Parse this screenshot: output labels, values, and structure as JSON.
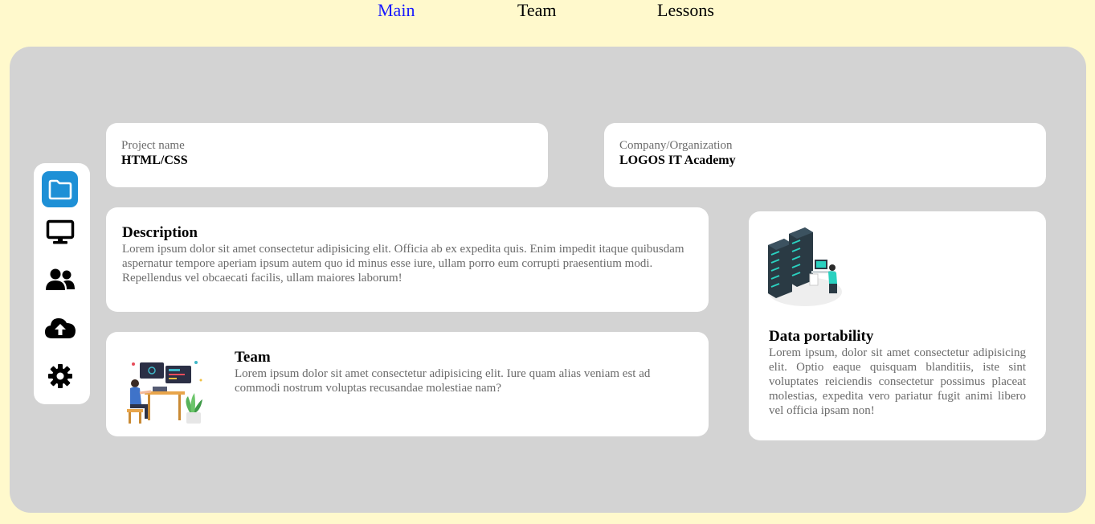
{
  "nav": {
    "main": "Main",
    "team": "Team",
    "lessons": "Lessons"
  },
  "sidebar": {
    "items": [
      {
        "icon": "folder-icon",
        "active": true
      },
      {
        "icon": "monitor-icon",
        "active": false
      },
      {
        "icon": "users-icon",
        "active": false
      },
      {
        "icon": "cloud-upload-icon",
        "active": false
      },
      {
        "icon": "gear-icon",
        "active": false
      }
    ],
    "active_color": "#1e90d6"
  },
  "project": {
    "label": "Project name",
    "value": "HTML/CSS"
  },
  "company": {
    "label": "Company/Organization",
    "value": "LOGOS IT Academy"
  },
  "description": {
    "title": "Description",
    "text": "Lorem ipsum dolor sit amet consectetur adipisicing elit. Officia ab ex expedita quis. Enim impedit itaque quibusdam aspernatur tempore aperiam ipsum autem quo id minus esse iure, ullam porro eum corrupti praesentium modi. Repellendus vel obcaecati facilis, ullam maiores laborum!"
  },
  "team": {
    "title": "Team",
    "text": "Lorem ipsum dolor sit amet consectetur adipisicing elit. Iure quam alias veniam est ad commodi nostrum voluptas recusandae molestiae nam?"
  },
  "portability": {
    "title": "Data portability",
    "text": "Lorem ipsum, dolor sit amet consectetur adipisicing elit. Optio eaque quisquam blanditiis, iste sint voluptates reiciendis consectetur possimus placeat molestias, expedita vero pariatur fugit animi libero vel officia ipsam non!"
  },
  "colors": {
    "background": "#fff9cc",
    "panel": "#d3d3d3",
    "active_link": "#1a1aff"
  }
}
